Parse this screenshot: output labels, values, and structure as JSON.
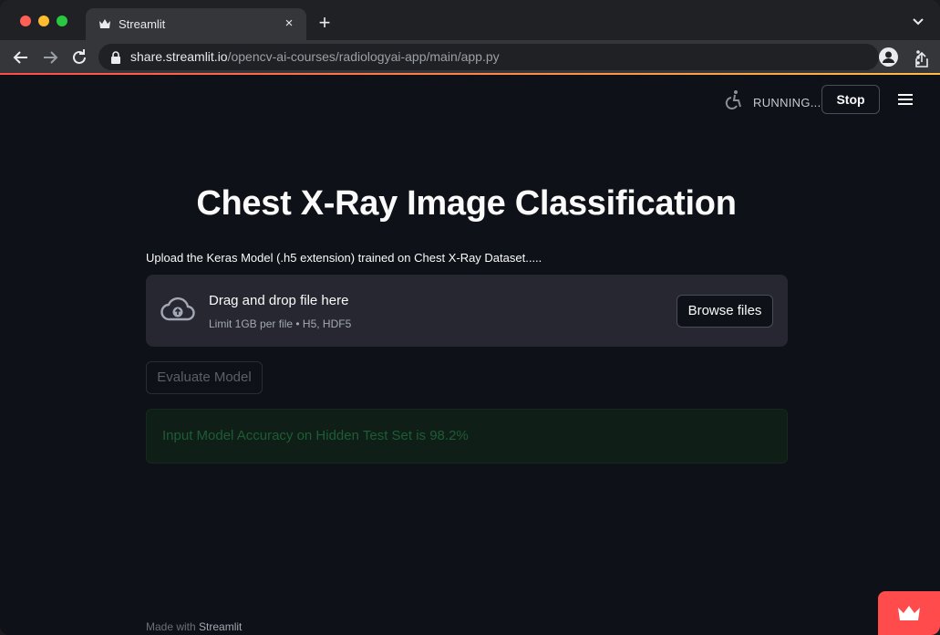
{
  "browser": {
    "tab_title": "Streamlit",
    "tab_close": "×",
    "new_tab": "+",
    "url_host": "share.streamlit.io",
    "url_path": "/opencv-ai-courses/radiologyai-app/main/app.py"
  },
  "status": {
    "running_text": "RUNNING...",
    "stop_label": "Stop"
  },
  "main": {
    "title": "Chest X-Ray Image Classification",
    "upload_label": "Upload the Keras Model (.h5 extension) trained on Chest X-Ray Dataset.....",
    "dropzone": {
      "title": "Drag and drop file here",
      "limit": "Limit 1GB per file • H5, HDF5",
      "browse_label": "Browse files"
    },
    "evaluate_label": "Evaluate Model",
    "result_text": "Input Model Accuracy on Hidden Test Set is 98.2%"
  },
  "footer": {
    "made_with": "Made with ",
    "brand": "Streamlit"
  },
  "colors": {
    "background": "#0e1117",
    "accent": "#ff4b4b",
    "secondary_accent": "#ffbd45",
    "success_text": "#1e5c35"
  },
  "icons": {
    "tab_favicon": "streamlit-crown-icon",
    "running": "accessibility-running-icon",
    "menu": "hamburger-icon",
    "upload": "cloud-upload-icon",
    "badge": "streamlit-crown-icon"
  }
}
